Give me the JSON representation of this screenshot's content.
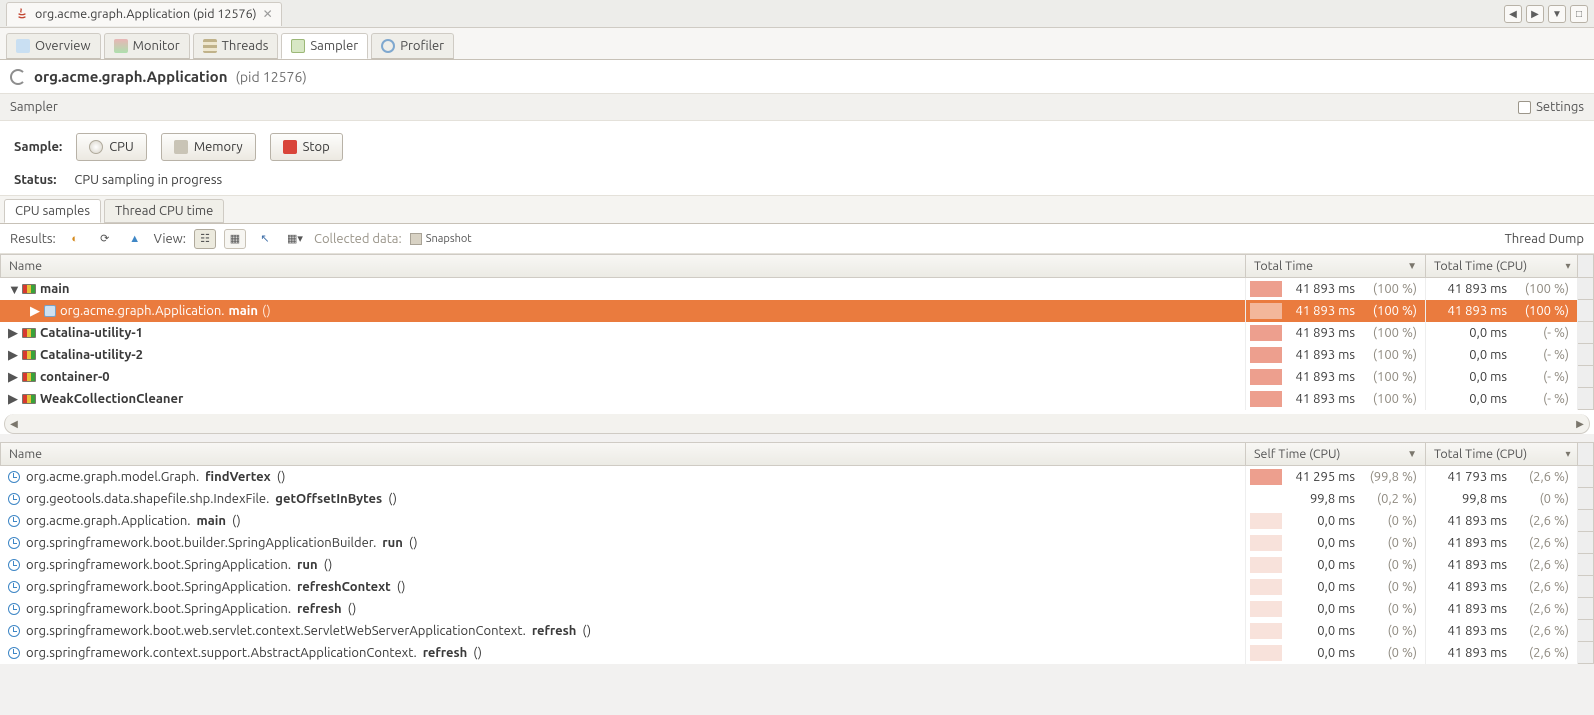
{
  "window": {
    "tab_title": "org.acme.graph.Application (pid 12576)"
  },
  "section_tabs": {
    "overview": "Overview",
    "monitor": "Monitor",
    "threads": "Threads",
    "sampler": "Sampler",
    "profiler": "Profiler"
  },
  "title": {
    "strong": "org.acme.graph.Application",
    "suffix": "(pid 12576)"
  },
  "subheader": {
    "label": "Sampler",
    "settings": "Settings"
  },
  "controls": {
    "sample_label": "Sample:",
    "cpu": "CPU",
    "memory": "Memory",
    "stop": "Stop",
    "status_label": "Status:",
    "status_value": "CPU sampling in progress"
  },
  "subtabs": {
    "cpu_samples": "CPU samples",
    "thread_cpu_time": "Thread CPU time"
  },
  "results_bar": {
    "results": "Results:",
    "view": "View:",
    "collected": "Collected data:",
    "snapshot": "Snapshot",
    "thread_dump": "Thread Dump"
  },
  "tree": {
    "headers": {
      "name": "Name",
      "total": "Total Time",
      "cpu": "Total Time (CPU)"
    },
    "rows": [
      {
        "indent": 0,
        "toggle": "▼",
        "kind": "thread",
        "bold": "main",
        "total": "41 893 ms",
        "total_pct": "(100 %)",
        "cpu": "41 893 ms",
        "cpu_pct": "(100 %)",
        "bar_pct": 18
      },
      {
        "indent": 1,
        "toggle": "▶",
        "kind": "method",
        "path": "org.acme.graph.Application.",
        "bold": "main",
        "args": " ()",
        "selected": true,
        "total": "41 893 ms",
        "total_pct": "(100 %)",
        "cpu": "41 893 ms",
        "cpu_pct": "(100 %)",
        "bar_pct": 18
      },
      {
        "indent": 0,
        "toggle": "▶",
        "kind": "thread",
        "bold": "Catalina-utility-1",
        "total": "41 893 ms",
        "total_pct": "(100 %)",
        "cpu": "0,0 ms",
        "cpu_pct": "(- %)",
        "bar_pct": 18
      },
      {
        "indent": 0,
        "toggle": "▶",
        "kind": "thread",
        "bold": "Catalina-utility-2",
        "total": "41 893 ms",
        "total_pct": "(100 %)",
        "cpu": "0,0 ms",
        "cpu_pct": "(- %)",
        "bar_pct": 18
      },
      {
        "indent": 0,
        "toggle": "▶",
        "kind": "thread",
        "bold": "container-0",
        "total": "41 893 ms",
        "total_pct": "(100 %)",
        "cpu": "0,0 ms",
        "cpu_pct": "(- %)",
        "bar_pct": 18
      },
      {
        "indent": 0,
        "toggle": "▶",
        "kind": "thread",
        "bold": "WeakCollectionCleaner",
        "total": "41 893 ms",
        "total_pct": "(100 %)",
        "cpu": "0,0 ms",
        "cpu_pct": "(- %)",
        "bar_pct": 18
      }
    ]
  },
  "hotspots": {
    "headers": {
      "name": "Name",
      "self": "Self Time (CPU)",
      "total": "Total Time (CPU)"
    },
    "rows": [
      {
        "path": "org.acme.graph.model.Graph.",
        "bold": "findVertex",
        "args": " ()",
        "self": "41 295 ms",
        "self_pct": "(99,8 %)",
        "self_bar": 18,
        "total": "41 793 ms",
        "total_pct": "(2,6 %)"
      },
      {
        "path": "org.geotools.data.shapefile.shp.IndexFile.",
        "bold": "getOffsetInBytes",
        "args": " ()",
        "self": "99,8 ms",
        "self_pct": "(0,2 %)",
        "self_bar": 0,
        "total": "99,8 ms",
        "total_pct": "(0 %)"
      },
      {
        "path": "org.acme.graph.Application.",
        "bold": "main",
        "args": " ()",
        "self": "0,0 ms",
        "self_pct": "(0 %)",
        "self_bar": 0,
        "pale": true,
        "total": "41 893 ms",
        "total_pct": "(2,6 %)"
      },
      {
        "path": "org.springframework.boot.builder.SpringApplicationBuilder.",
        "bold": "run",
        "args": " ()",
        "self": "0,0 ms",
        "self_pct": "(0 %)",
        "self_bar": 0,
        "pale": true,
        "total": "41 893 ms",
        "total_pct": "(2,6 %)"
      },
      {
        "path": "org.springframework.boot.SpringApplication.",
        "bold": "run",
        "args": " ()",
        "self": "0,0 ms",
        "self_pct": "(0 %)",
        "self_bar": 0,
        "pale": true,
        "total": "41 893 ms",
        "total_pct": "(2,6 %)"
      },
      {
        "path": "org.springframework.boot.SpringApplication.",
        "bold": "refreshContext",
        "args": " ()",
        "self": "0,0 ms",
        "self_pct": "(0 %)",
        "self_bar": 0,
        "pale": true,
        "total": "41 893 ms",
        "total_pct": "(2,6 %)"
      },
      {
        "path": "org.springframework.boot.SpringApplication.",
        "bold": "refresh",
        "args": " ()",
        "self": "0,0 ms",
        "self_pct": "(0 %)",
        "self_bar": 0,
        "pale": true,
        "total": "41 893 ms",
        "total_pct": "(2,6 %)"
      },
      {
        "path": "org.springframework.boot.web.servlet.context.ServletWebServerApplicationContext.",
        "bold": "refresh",
        "args": " ()",
        "self": "0,0 ms",
        "self_pct": "(0 %)",
        "self_bar": 0,
        "pale": true,
        "total": "41 893 ms",
        "total_pct": "(2,6 %)"
      },
      {
        "path": "org.springframework.context.support.AbstractApplicationContext.",
        "bold": "refresh",
        "args": " ()",
        "self": "0,0 ms",
        "self_pct": "(0 %)",
        "self_bar": 0,
        "pale": true,
        "total": "41 893 ms",
        "total_pct": "(2,6 %)"
      }
    ]
  }
}
